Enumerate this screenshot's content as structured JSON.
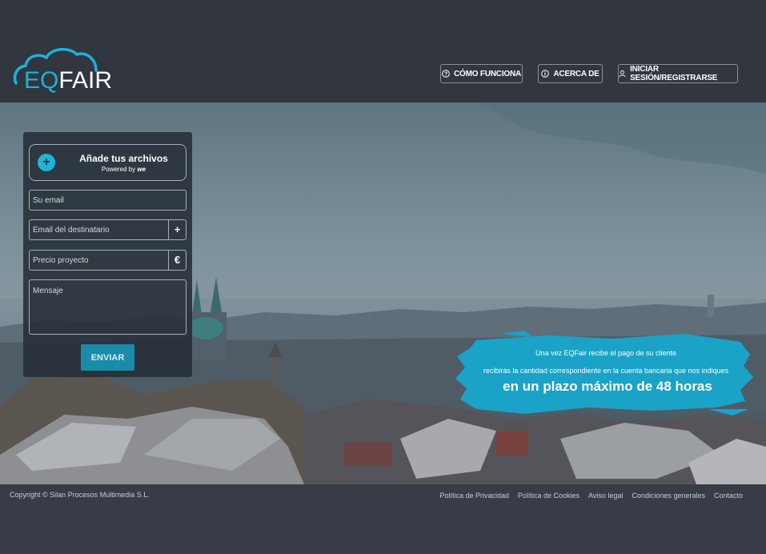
{
  "brand": {
    "logo_prefix": "EQ",
    "logo_suffix": "FAIR",
    "accent_color": "#1bb3d8"
  },
  "nav": {
    "how_it_works": "CÓMO FUNCIONA",
    "about": "ACERCA DE",
    "login": "INICIAR SESIÓN/REGISTRARSE",
    "icons": [
      "question-circle-icon",
      "info-circle-icon",
      "user-icon"
    ]
  },
  "form": {
    "upload_title": "Añade tus archivos",
    "upload_powered": "Powered by",
    "upload_brand": "we",
    "email_placeholder": "Su email",
    "recipient_placeholder": "Email del destinatario",
    "recipient_addon": "+",
    "price_placeholder": "Precio proyecto",
    "price_addon": "€",
    "message_placeholder": "Mensaje",
    "send_label": "ENVIAR"
  },
  "banner": {
    "line1": "Una vez EQFair recibe el pago de su cliente",
    "line2": "recibirás la cantidad correspondiente en la cuenta bancaria que nos indiques",
    "line3": "en un plazo máximo de 48 horas",
    "color": "#1aa3c6"
  },
  "footer": {
    "copyright": "Copyright © Silan Procesos Multimedia S.L.",
    "links": [
      "Política de Privacidad",
      "Política de Cookies",
      "Aviso legal",
      "Condiciones generales",
      "Contacto"
    ]
  }
}
